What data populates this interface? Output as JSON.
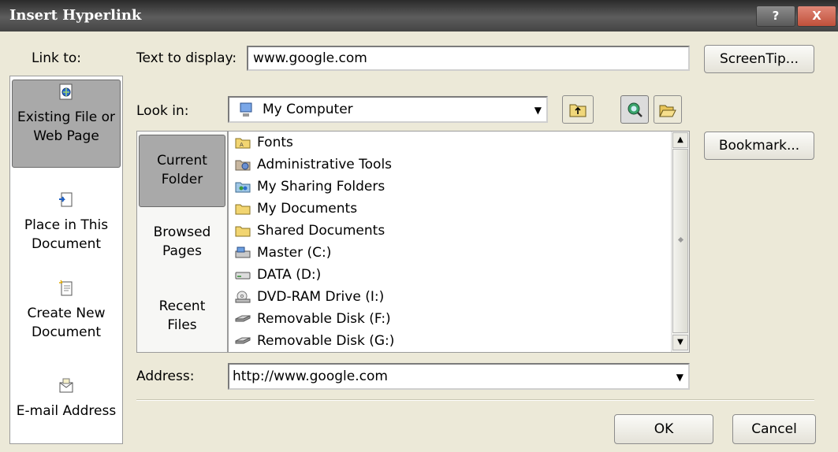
{
  "window": {
    "title": "Insert Hyperlink",
    "help_label": "?",
    "close_label": "X"
  },
  "link_to": {
    "label": "Link to:",
    "items": [
      {
        "line1": "Existing File or",
        "line2": "Web Page",
        "selected": true,
        "icon": "existing-file-icon"
      },
      {
        "line1": "Place in This",
        "line2": "Document",
        "selected": false,
        "icon": "place-in-document-icon"
      },
      {
        "line1": "Create New",
        "line2": "Document",
        "selected": false,
        "icon": "new-document-icon"
      },
      {
        "line1": "E-mail Address",
        "line2": "",
        "selected": false,
        "icon": "email-icon"
      }
    ]
  },
  "text_to_display": {
    "label": "Text to display:",
    "value": "www.google.com"
  },
  "look_in": {
    "label": "Look in:",
    "value": "My Computer"
  },
  "folder_nav": [
    {
      "line1": "Current",
      "line2": "Folder",
      "selected": true
    },
    {
      "line1": "Browsed",
      "line2": "Pages",
      "selected": false
    },
    {
      "line1": "Recent",
      "line2": "Files",
      "selected": false
    }
  ],
  "files": [
    {
      "name": "Fonts",
      "icon": "folder-icon"
    },
    {
      "name": "Administrative Tools",
      "icon": "admin-tools-icon"
    },
    {
      "name": "My Sharing Folders",
      "icon": "sharing-folder-icon"
    },
    {
      "name": "My Documents",
      "icon": "folder-icon"
    },
    {
      "name": "Shared Documents",
      "icon": "folder-icon"
    },
    {
      "name": "Master (C:)",
      "icon": "drive-icon"
    },
    {
      "name": "DATA (D:)",
      "icon": "drive-icon"
    },
    {
      "name": "DVD-RAM Drive (I:)",
      "icon": "dvd-drive-icon"
    },
    {
      "name": "Removable Disk (F:)",
      "icon": "removable-disk-icon"
    },
    {
      "name": "Removable Disk (G:)",
      "icon": "removable-disk-icon"
    }
  ],
  "address": {
    "label": "Address:",
    "value": "http://www.google.com"
  },
  "buttons": {
    "screentip": "ScreenTip...",
    "bookmark": "Bookmark...",
    "ok": "OK",
    "cancel": "Cancel"
  },
  "colors": {
    "dialog_bg": "#ece9d8",
    "selected_bg": "#a9a9a9",
    "title_bg": "#3a3a3a"
  }
}
